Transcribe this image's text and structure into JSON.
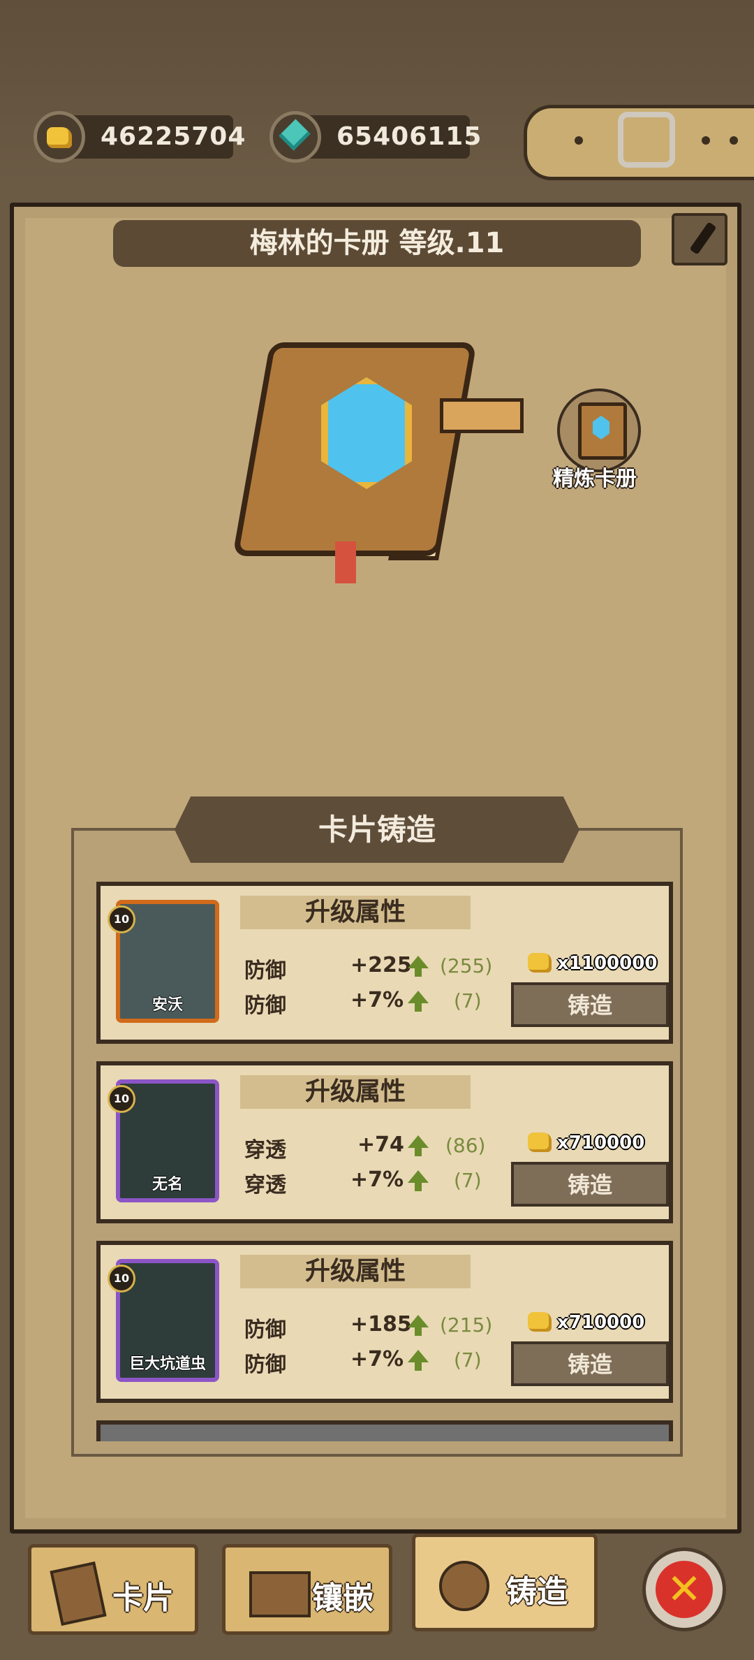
{
  "currency": {
    "gold": "46225704",
    "gems": "65406115"
  },
  "header": {
    "title": "梅林的卡册 等级.11"
  },
  "refine": {
    "label": "精炼卡册"
  },
  "forge": {
    "title": "卡片铸造",
    "cards": [
      {
        "level": "10",
        "name": "安沃",
        "section": "升级属性",
        "stat1": {
          "label": "防御",
          "value": "+225",
          "prev": "(255)"
        },
        "stat2": {
          "label": "防御",
          "value": "+7%",
          "prev": "(7)"
        },
        "cost": "x1100000",
        "button": "铸造"
      },
      {
        "level": "10",
        "name": "无名",
        "section": "升级属性",
        "stat1": {
          "label": "穿透",
          "value": "+74",
          "prev": "(86)"
        },
        "stat2": {
          "label": "穿透",
          "value": "+7%",
          "prev": "(7)"
        },
        "cost": "x710000",
        "button": "铸造"
      },
      {
        "level": "10",
        "name": "巨大坑道虫",
        "section": "升级属性",
        "stat1": {
          "label": "防御",
          "value": "+185",
          "prev": "(215)"
        },
        "stat2": {
          "label": "防御",
          "value": "+7%",
          "prev": "(7)"
        },
        "cost": "x710000",
        "button": "铸造"
      }
    ]
  },
  "tabs": [
    {
      "label": "卡片"
    },
    {
      "label": "镶嵌"
    },
    {
      "label": "铸造",
      "active": true
    }
  ],
  "icons": {
    "close": "close-icon",
    "edit": "brush-icon",
    "gold": "gold-icon",
    "gem": "gem-icon"
  }
}
